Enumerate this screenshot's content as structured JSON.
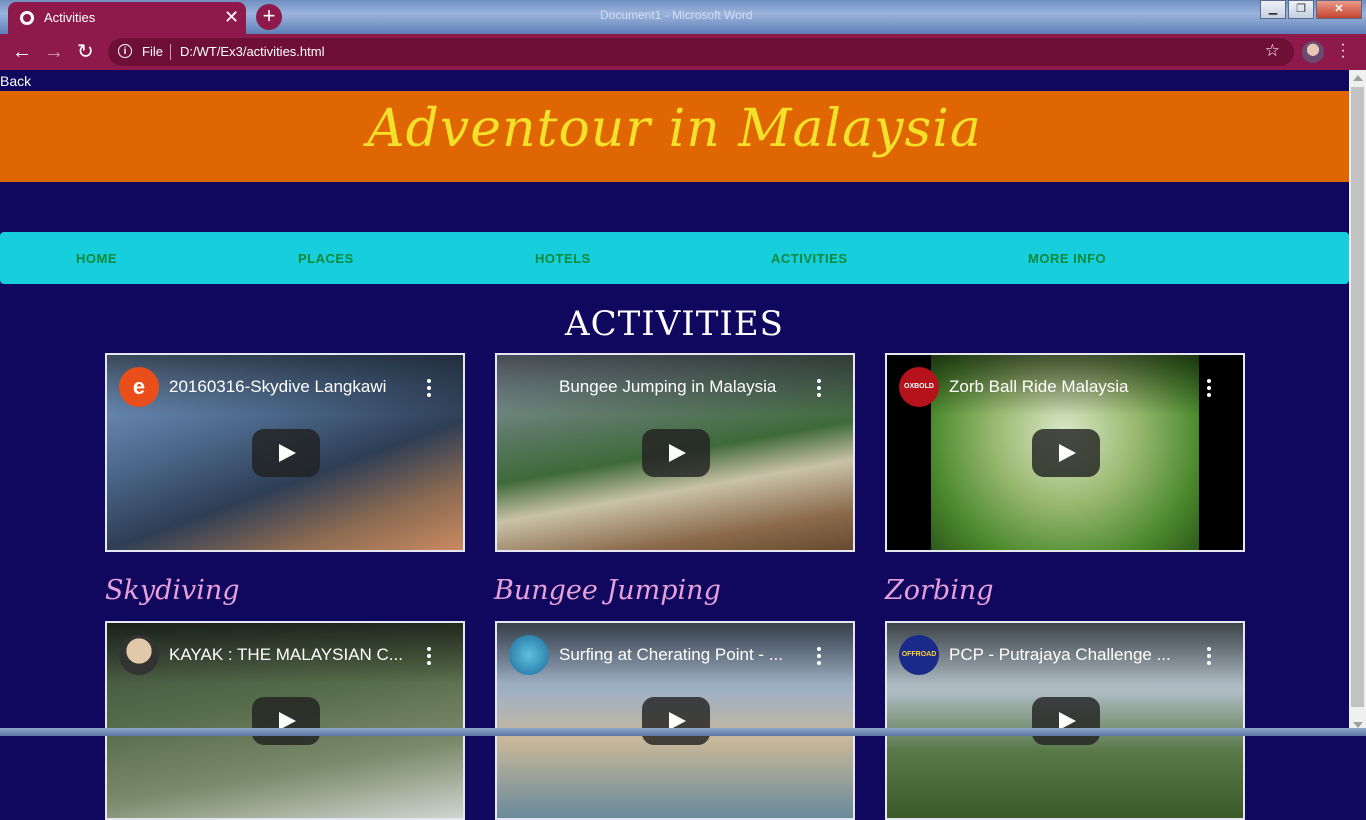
{
  "browser": {
    "tab_title": "Activities",
    "window_title": "Document1 - Microsoft Word",
    "address_scheme": "File",
    "address_url": "D:/WT/Ex3/activities.html"
  },
  "page": {
    "back_link": "Back",
    "banner_title": "Adventour in Malaysia",
    "nav": [
      "HOME",
      "PLACES",
      "HOTELS",
      "ACTIVITIES",
      "MORE INFO"
    ],
    "section_title": "ACTIVITIES",
    "videos": [
      {
        "title": "20160316-Skydive Langkawi",
        "channel_letter": "e",
        "caption": "Skydiving"
      },
      {
        "title": "Bungee Jumping in Malaysia",
        "channel_letter": "",
        "caption": "Bungee Jumping"
      },
      {
        "title": "Zorb Ball Ride Malaysia",
        "channel_letter": "OXBOLD",
        "caption": "Zorbing"
      },
      {
        "title": "KAYAK : THE MALAYSIAN C...",
        "channel_letter": ""
      },
      {
        "title": "Surfing at Cherating Point - ...",
        "channel_letter": ""
      },
      {
        "title": "PCP - Putrajaya Challenge ...",
        "channel_letter": "OFFROAD"
      }
    ]
  },
  "colors": {
    "page_bg": "#10085e",
    "banner_bg": "#e06503",
    "banner_text": "#f4e12a",
    "navbar_bg": "#16cedc",
    "nav_text": "#0d8a3a",
    "caption_text": "#e7a0d9",
    "browser_accent": "#8d1a4a"
  }
}
